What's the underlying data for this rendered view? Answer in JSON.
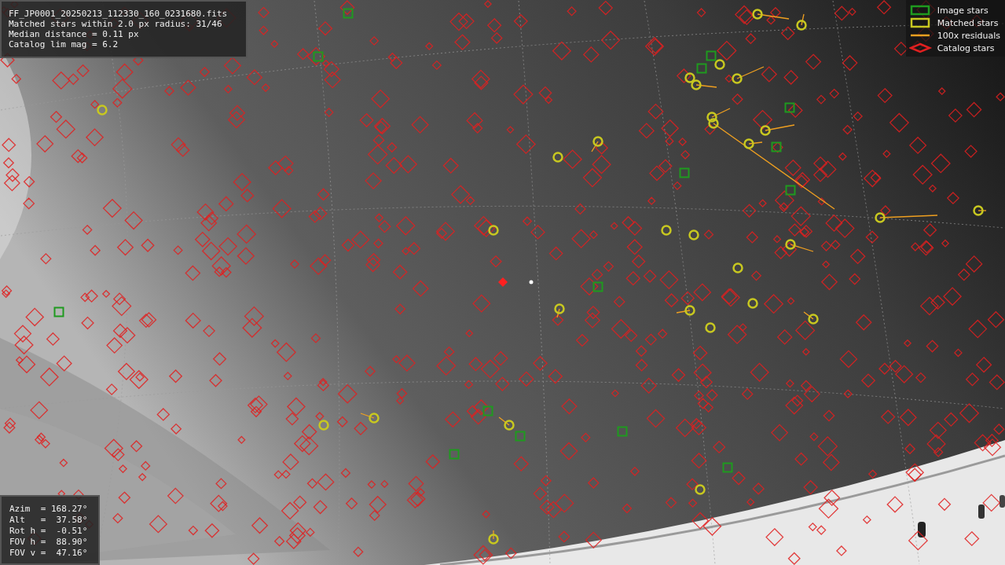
{
  "info_panel": {
    "lines": [
      "FF_JP0001_20250213_112330_160_0231680.fits",
      "Matched stars within 2.0 px radius: 31/46",
      "Median distance = 0.11 px",
      "Catalog lim mag = 6.2"
    ]
  },
  "legend": {
    "items": [
      {
        "kind": "box",
        "label": "Image stars",
        "color": "#1f9a1f"
      },
      {
        "kind": "box",
        "label": "Matched stars",
        "color": "#c8c820"
      },
      {
        "kind": "line",
        "label": "100x residuals",
        "color": "#f0a020"
      },
      {
        "kind": "diamond",
        "label": "Catalog stars",
        "color": "#e02020"
      }
    ]
  },
  "pointing_panel": {
    "lines": [
      "Azim  = 168.27°",
      "Alt   =  37.58°",
      "Rot h =  -0.51°",
      "FOV h =  88.90°",
      "FOV v =  47.16°"
    ]
  }
}
